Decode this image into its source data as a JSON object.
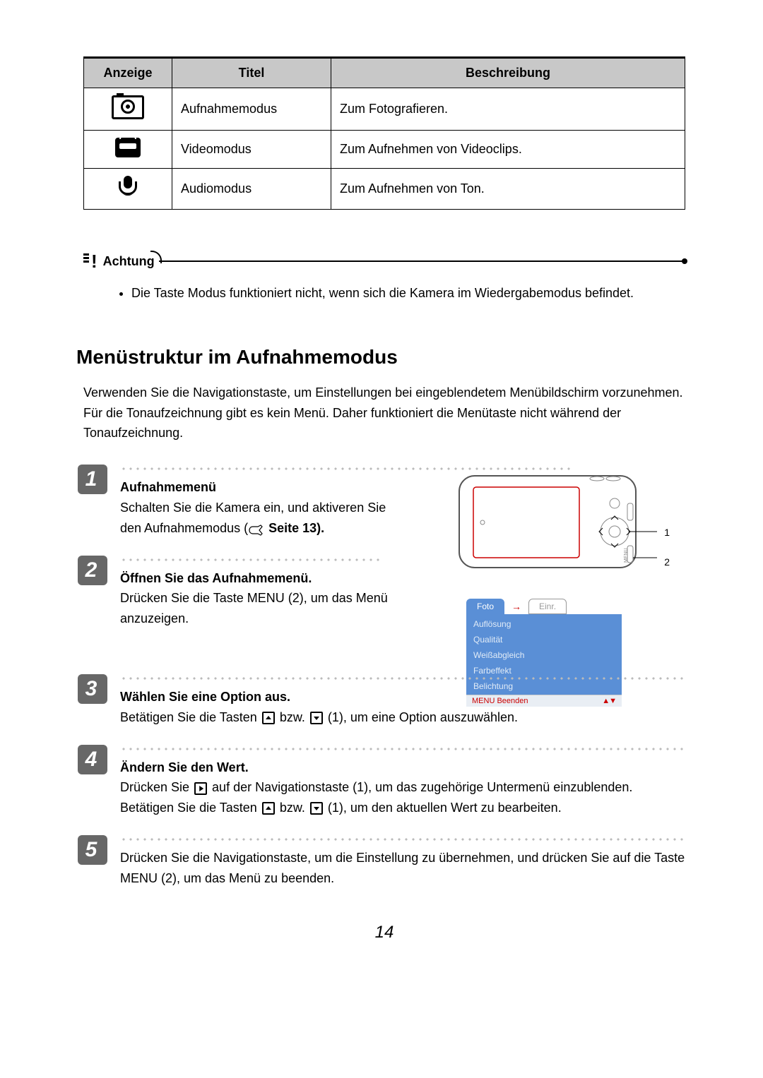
{
  "table": {
    "headers": {
      "anzeige": "Anzeige",
      "titel": "Titel",
      "beschreibung": "Beschreibung"
    },
    "rows": [
      {
        "icon": "camera-mode-icon",
        "titel": "Aufnahmemodus",
        "beschreibung": "Zum Fotografieren."
      },
      {
        "icon": "video-mode-icon",
        "titel": "Videomodus",
        "beschreibung": "Zum Aufnehmen von Videoclips."
      },
      {
        "icon": "audio-mode-icon",
        "titel": "Audiomodus",
        "beschreibung": "Zum Aufnehmen von Ton."
      }
    ]
  },
  "attention": {
    "label": "Achtung",
    "bullet": "Die Taste Modus funktioniert nicht, wenn sich die Kamera im Wiedergabemodus befindet."
  },
  "section": {
    "heading": "Menüstruktur im Aufnahmemodus",
    "paragraph": "Verwenden Sie die Navigationstaste, um Einstellungen bei eingeblendetem Menübildschirm vorzunehmen. Für die Tonaufzeichnung gibt es kein Menü. Daher funktioniert die Menütaste nicht während der Tonaufzeichnung."
  },
  "steps": [
    {
      "num": "1",
      "title": "Aufnahmemenü",
      "body_before": "Schalten Sie die Kamera ein, und aktiveren Sie den Aufnahmemodus (",
      "body_ref": " Seite 13).",
      "body_after": ""
    },
    {
      "num": "2",
      "title": "Öffnen Sie das Aufnahmemenü.",
      "body": "Drücken Sie die Taste MENU (2), um das Menü anzuzeigen."
    },
    {
      "num": "3",
      "title": "Wählen Sie eine Option aus.",
      "body_before": "Betätigen Sie die Tasten ",
      "body_mid": " bzw. ",
      "body_after": " (1), um eine Option auszuwählen."
    },
    {
      "num": "4",
      "title": "Ändern Sie den Wert.",
      "p1_before": "Drücken Sie ",
      "p1_after": " auf der Navigationstaste (1), um das zugehörige Untermenü einzublenden. Betätigen Sie die Tasten ",
      "p1_mid": " bzw. ",
      "p1_end": " (1), um den aktuellen Wert zu bearbeiten."
    },
    {
      "num": "5",
      "body": "Drücken Sie die Navigationstaste, um die Einstellung zu übernehmen, und drücken Sie auf die Taste MENU (2), um das Menü zu beenden."
    }
  ],
  "diagram": {
    "callouts": {
      "one": "1",
      "two": "2"
    },
    "menu": {
      "tab_active": "Foto",
      "tab_inactive": "Einr.",
      "arrow": "→",
      "items": [
        "Auflösung",
        "Qualität",
        "Weißabgleich",
        "Farbeffekt",
        "Belichtung"
      ],
      "footer_left": "MENU Beenden",
      "footer_right": "▲▼"
    }
  },
  "page_number": "14"
}
